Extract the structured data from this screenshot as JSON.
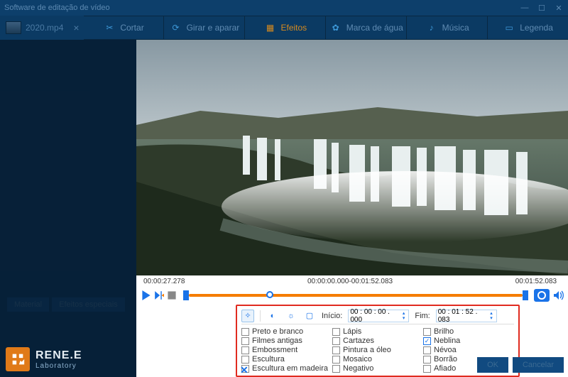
{
  "window": {
    "title": "Software de editação de vídeo"
  },
  "file": {
    "name": "2020.mp4"
  },
  "toolbar": {
    "cut": "Cortar",
    "rotate": "Girar e aparar",
    "effects": "Efeitos",
    "watermark": "Marca de água",
    "music": "Música",
    "subtitle": "Legenda"
  },
  "sidebar": {
    "material": "Material",
    "effect_list": "Efeitos especiais"
  },
  "brand": {
    "name": "RENE.E",
    "sub": "Laboratory"
  },
  "timeline": {
    "current": "00:00:27.278",
    "range": "00:00:00.000-00:01:52.083",
    "total": "00:01:52.083"
  },
  "fx": {
    "start_label": "Início:",
    "start_value": "00 : 00 : 00 . 000",
    "end_label": "Fim:",
    "end_value": "00 : 01 : 52 . 083",
    "col1": [
      {
        "label": "Preto e branco",
        "checked": false
      },
      {
        "label": "Filmes antigas",
        "checked": false
      },
      {
        "label": "Embossment",
        "checked": false
      },
      {
        "label": "Escultura",
        "checked": false
      },
      {
        "label": "Escultura em madeira",
        "checked": false
      }
    ],
    "col2": [
      {
        "label": "Lápis",
        "checked": false
      },
      {
        "label": "Cartazes",
        "checked": false
      },
      {
        "label": "Pintura a óleo",
        "checked": false
      },
      {
        "label": "Mosaico",
        "checked": false
      },
      {
        "label": "Negativo",
        "checked": false
      }
    ],
    "col3": [
      {
        "label": "Brilho",
        "checked": false
      },
      {
        "label": "Neblina",
        "checked": true
      },
      {
        "label": "Névoa",
        "checked": false
      },
      {
        "label": "Borrão",
        "checked": false
      },
      {
        "label": "Afiado",
        "checked": false
      }
    ]
  },
  "footer": {
    "ok": "OK",
    "cancel": "Cancelar"
  }
}
